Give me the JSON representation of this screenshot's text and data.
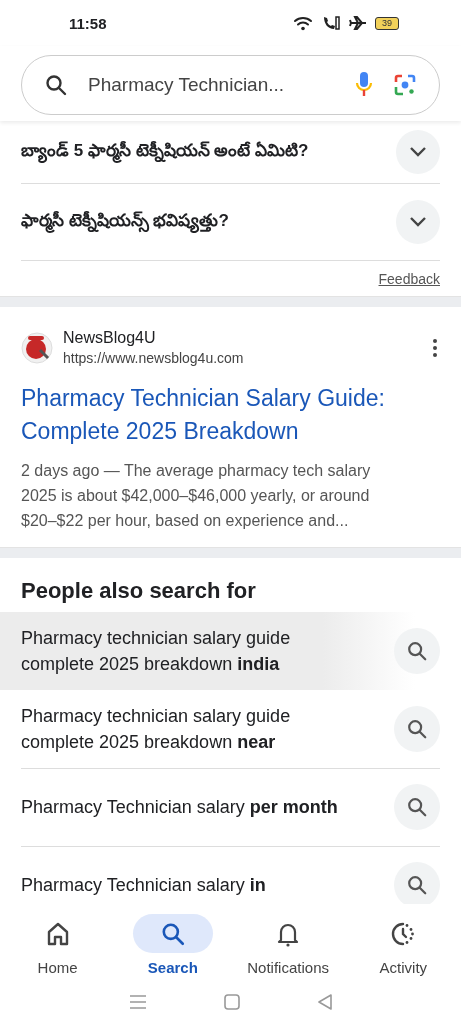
{
  "status_bar": {
    "time": "11:58",
    "battery": "39"
  },
  "search": {
    "value": "Pharmacy Technician..."
  },
  "questions": [
    {
      "text": "బ్యాండ్ 5 ఫార్మసీ టెక్నీషియన్ అంటే ఏమిటి?",
      "expanded": false
    },
    {
      "text": "ఫార్మసీ టెక్నీషియన్స్ భవిష్యత్తు?",
      "expanded": false
    }
  ],
  "feedback": "Feedback",
  "result": {
    "source": "NewsBlog4U",
    "url": "https://www.newsblog4u.com",
    "title": "Pharmacy Technician Salary Guide: Complete 2025 Breakdown",
    "snippet": "2 days ago — The average pharmacy tech salary 2025 is about $42,000–$46,000 yearly, or around $20–$22 per hour, based on experience and..."
  },
  "related": {
    "title": "People also search for",
    "items": [
      {
        "text": "Pharmacy technician salary guide complete 2025 breakdown **india**",
        "selected": true
      },
      {
        "text": "Pharmacy technician salary guide complete 2025 breakdown **near**",
        "selected": false
      },
      {
        "text": "Pharmacy Technician salary **per month**",
        "selected": false
      },
      {
        "text": "Pharmacy Technician salary **in**",
        "selected": false
      }
    ]
  },
  "nav": [
    {
      "label": "Home",
      "kind": "home",
      "selected": false
    },
    {
      "label": "Search",
      "kind": "search",
      "selected": true
    },
    {
      "label": "Notifications",
      "kind": "bell",
      "selected": false
    },
    {
      "label": "Activity",
      "kind": "activity",
      "selected": false
    }
  ]
}
